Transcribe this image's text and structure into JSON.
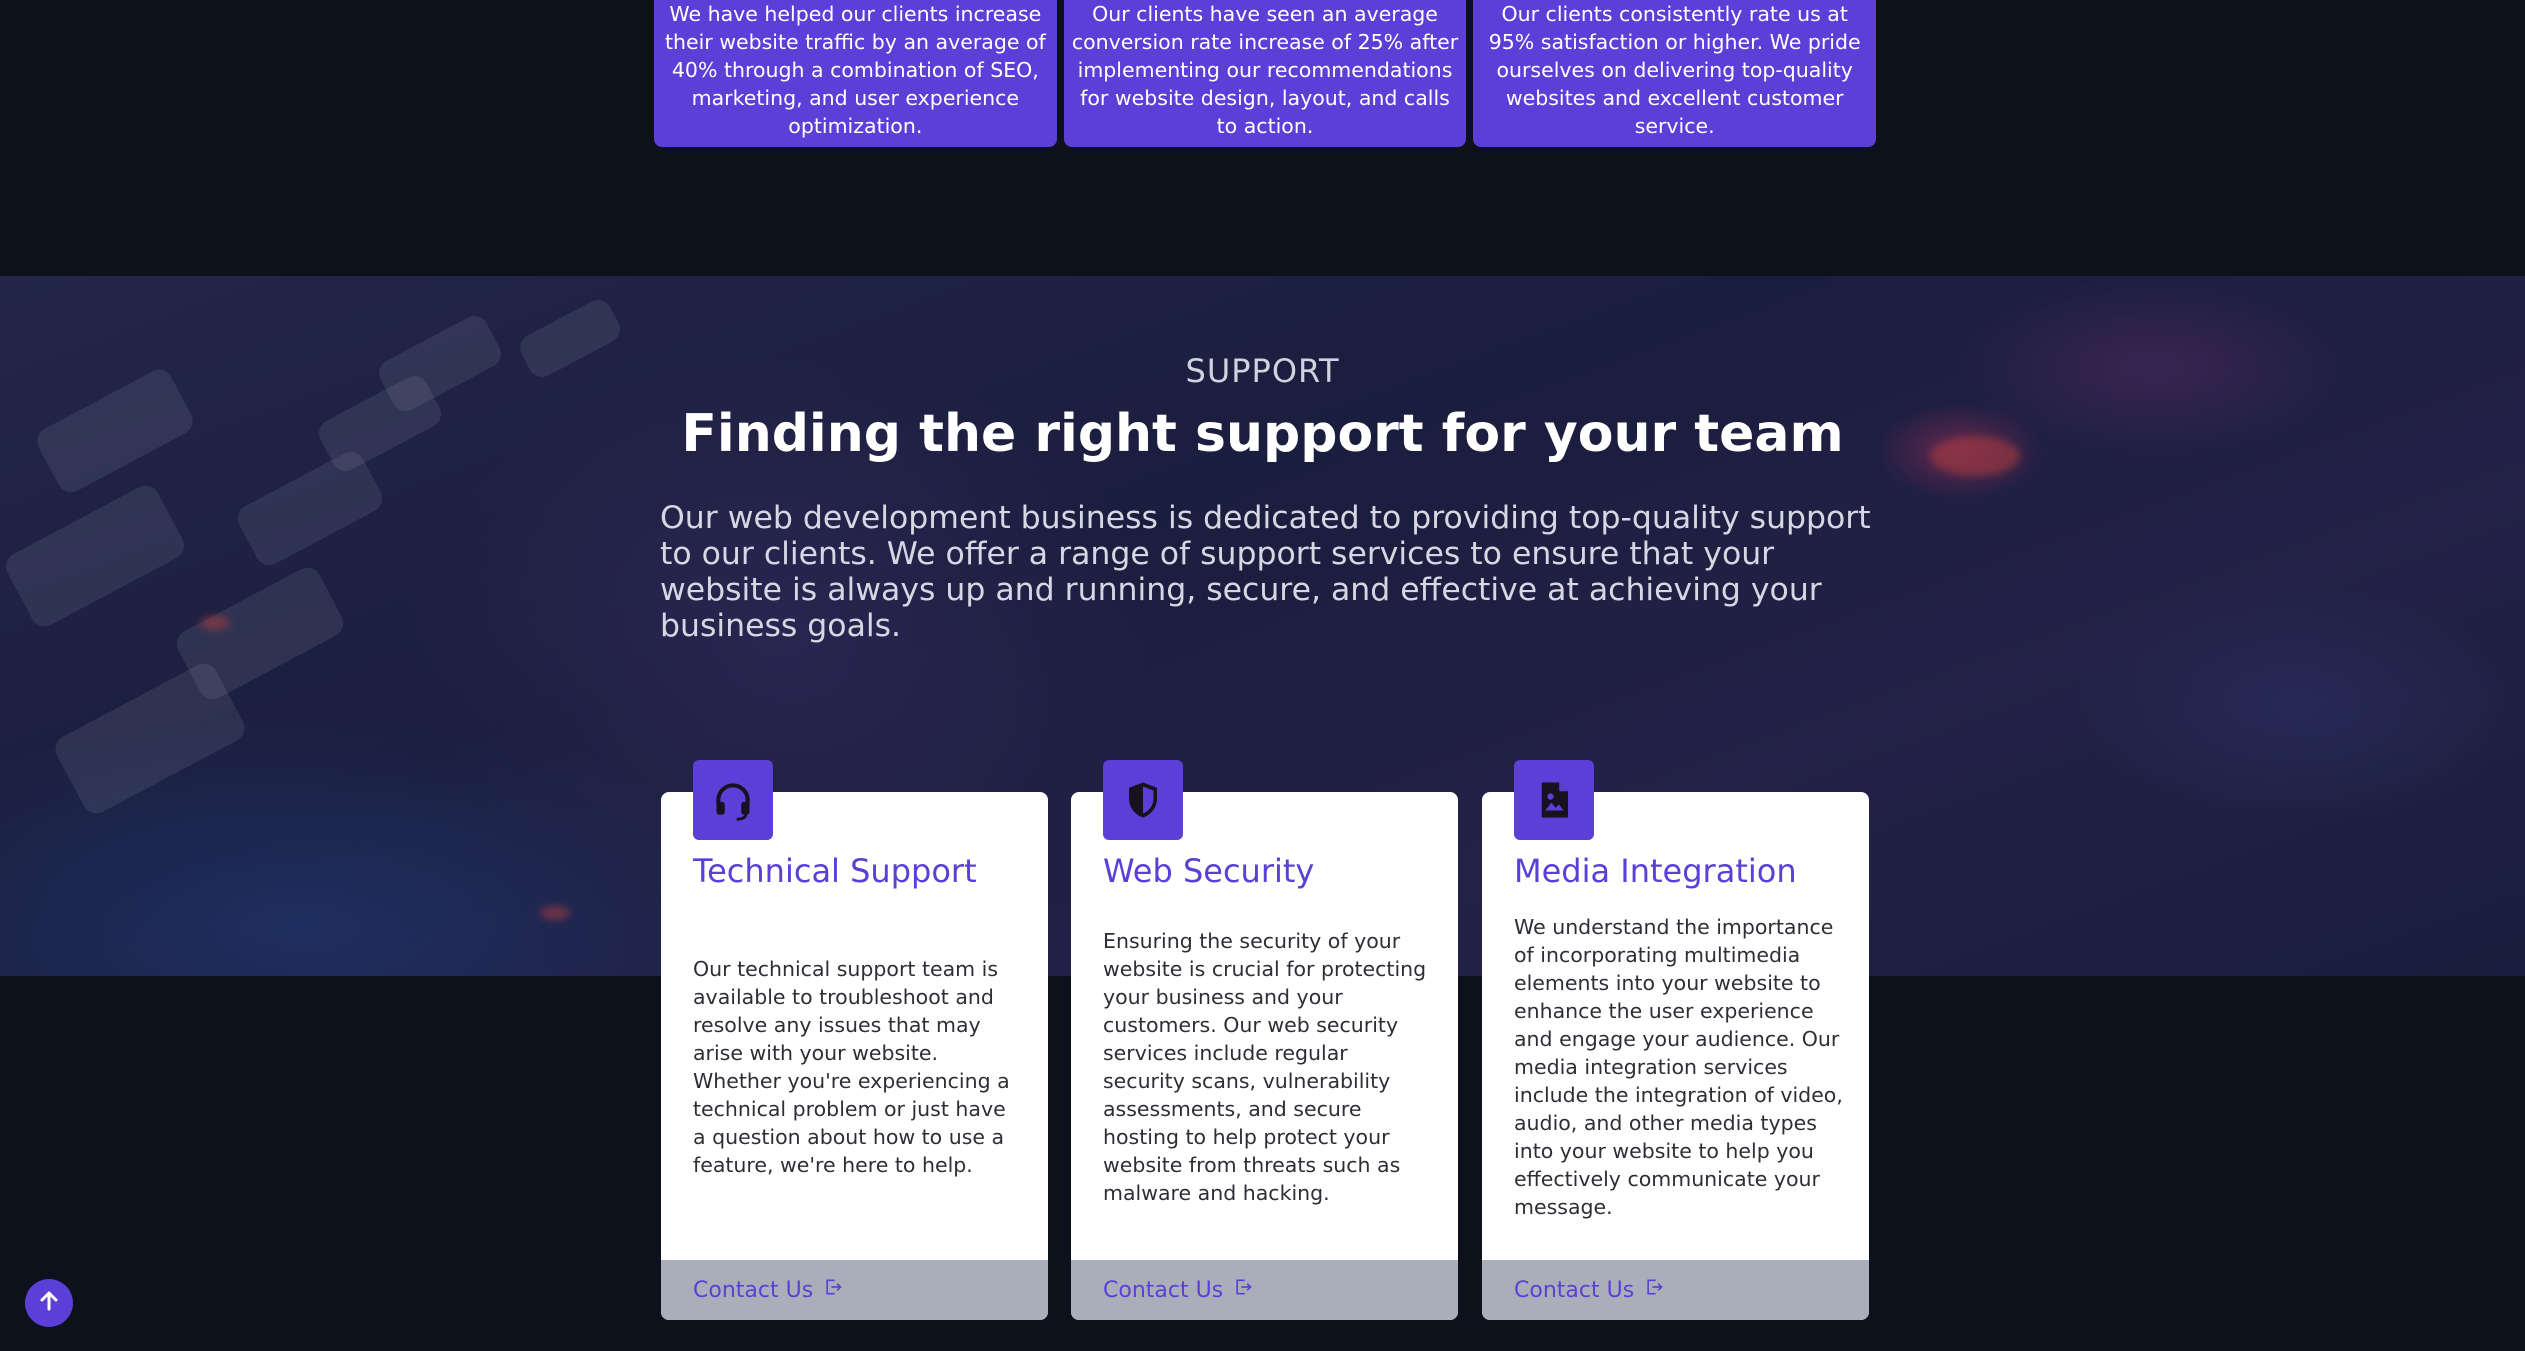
{
  "stats": [
    {
      "text": "We have helped our clients increase their website traffic by an average of 40% through a combination of SEO, marketing, and user experience optimization."
    },
    {
      "text": "Our clients have seen an average conversion rate increase of 25% after implementing our recommendations for website design, layout, and calls to action."
    },
    {
      "text": "Our clients consistently rate us at 95% satisfaction or higher. We pride ourselves on delivering top-quality websites and excellent customer service."
    }
  ],
  "support": {
    "eyebrow": "SUPPORT",
    "title": "Finding the right support for your team",
    "intro": "Our web development business is dedicated to providing top-quality support to our clients. We offer a range of support services to ensure that your website is always up and running, secure, and effective at achieving your business goals."
  },
  "services": [
    {
      "icon": "headset-icon",
      "title": "Technical Support",
      "body": "Our technical support team is available to troubleshoot and resolve any issues that may arise with your website. Whether you're experiencing a technical problem or just have a question about how to use a feature, we're here to help.",
      "cta": "Contact Us"
    },
    {
      "icon": "shield-icon",
      "title": "Web Security",
      "body": "Ensuring the security of your website is crucial for protecting your business and your customers. Our web security services include regular security scans, vulnerability assessments, and secure hosting to help protect your website from threats such as malware and hacking.",
      "cta": "Contact Us"
    },
    {
      "icon": "image-icon",
      "title": "Media Integration",
      "body": "We understand the importance of incorporating multimedia elements into your website to enhance the user experience and engage your audience. Our media integration services include the integration of video, audio, and other media types into your website to help you effectively communicate your message.",
      "cta": "Contact Us"
    }
  ],
  "scroll_top": {
    "icon": "arrow-up-icon"
  },
  "colors": {
    "accent": "#5b3fd6",
    "background": "#0d111c",
    "card_footer": "#aaaebb"
  }
}
